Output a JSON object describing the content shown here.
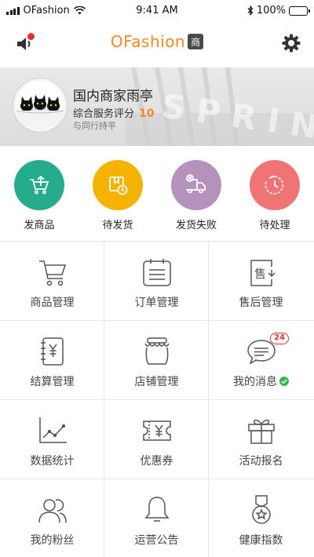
{
  "status_bar": {
    "carrier": "OFashion",
    "time": "9:41 AM",
    "battery": "100%",
    "battery_level": 1.0
  },
  "navbar": {
    "brand": "OFashion",
    "brand_badge": "商",
    "left_icon": "speaker-icon",
    "right_icon": "gear-icon",
    "accent_color": "#f08a27"
  },
  "profile": {
    "shop_name": "国内商家雨亭",
    "rating_label": "综合服务评分",
    "rating_score": "10",
    "peer_text": "与同行持平",
    "banner_bg_text": "SPRING"
  },
  "quick_actions": [
    {
      "label": "发商品",
      "icon": "upload-cart-icon",
      "color": "#25ad8b"
    },
    {
      "label": "待发货",
      "icon": "package-clock-icon",
      "color": "#f4b301"
    },
    {
      "label": "发货失败",
      "icon": "truck-failed-icon",
      "color": "#b592bb"
    },
    {
      "label": "待处理",
      "icon": "pending-clock-icon",
      "color": "#f17474"
    }
  ],
  "grid": [
    {
      "label": "商品管理",
      "icon": "cart-icon"
    },
    {
      "label": "订单管理",
      "icon": "order-list-icon"
    },
    {
      "label": "售后管理",
      "icon": "after-sales-icon"
    },
    {
      "label": "结算管理",
      "icon": "settlement-icon"
    },
    {
      "label": "店铺管理",
      "icon": "shop-jar-icon"
    },
    {
      "label": "我的消息",
      "icon": "message-icon",
      "badge": "24",
      "verified": true
    },
    {
      "label": "数据统计",
      "icon": "chart-icon"
    },
    {
      "label": "优惠券",
      "icon": "coupon-icon"
    },
    {
      "label": "活动报名",
      "icon": "gift-icon"
    },
    {
      "label": "我的粉丝",
      "icon": "fans-icon"
    },
    {
      "label": "运营公告",
      "icon": "bell-icon"
    },
    {
      "label": "健康指数",
      "icon": "medal-icon"
    }
  ]
}
